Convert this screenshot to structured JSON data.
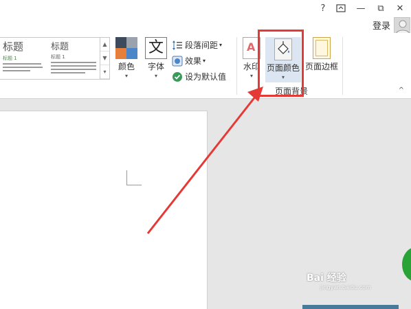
{
  "titlebar": {
    "help_label": "?",
    "restore_label": "⧉",
    "minimize_label": "—",
    "close_label": "✕",
    "login_label": "登录"
  },
  "gallery": {
    "styles": [
      {
        "title": "标题",
        "sub": "标题 1"
      },
      {
        "title": "标题",
        "sub": "标题 1"
      }
    ],
    "scroll_up": "▲",
    "scroll_down": "▼",
    "scroll_more": "▾"
  },
  "ribbon": {
    "colors_label": "颜色",
    "fonts_label": "字体",
    "paragraph_spacing_label": "段落间距",
    "effects_label": "效果",
    "set_default_label": "设为默认值",
    "watermark_label": "水印",
    "page_color_label": "页面颜色",
    "page_border_label": "页面边框",
    "page_background_group": "页面背景",
    "caret": "▾",
    "collapse": "^"
  },
  "watermark_brand": {
    "text": "Bai 经验",
    "sub": "jingyan.baidu.com"
  },
  "colors": {
    "accent_red": "#e53935",
    "swatch_dark": "#3c4a5c",
    "swatch_gray": "#9aa3ad",
    "swatch_orange": "#e67e3c",
    "swatch_blue": "#4a86c8"
  }
}
